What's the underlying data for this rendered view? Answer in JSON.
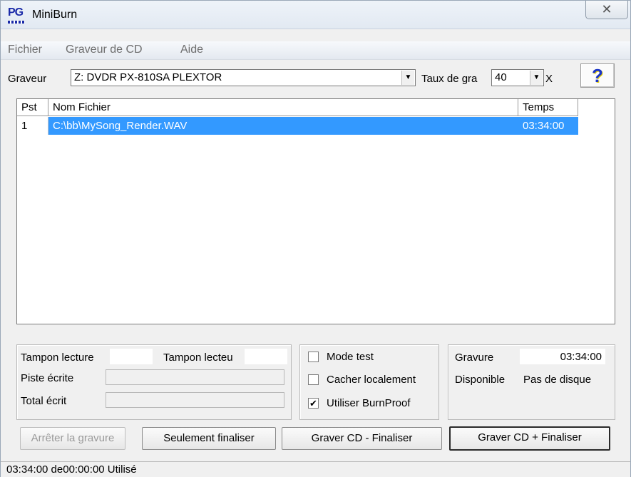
{
  "window": {
    "title": "MiniBurn",
    "close_glyph": "✕"
  },
  "menu": [
    "Fichier",
    "Graveur de CD",
    "Aide"
  ],
  "drive": {
    "label": "Graveur",
    "value": "Z: DVDR  PX-810SA  PLEXTOR"
  },
  "speed": {
    "label": "Taux de gra",
    "value": "40",
    "unit": "X"
  },
  "help": {
    "glyph": "?"
  },
  "list": {
    "columns": [
      "Pst",
      "Nom Fichier",
      "Temps"
    ],
    "rows": [
      {
        "pst": "1",
        "file": "C:\\bb\\MySong_Render.WAV",
        "time": "03:34:00"
      }
    ]
  },
  "buffers": {
    "read_label": "Tampon lecture",
    "reader_label": "Tampon lecteu",
    "track_label": "Piste écrite",
    "total_label": "Total écrit"
  },
  "options": {
    "test_mode": {
      "label": "Mode test",
      "checked": false
    },
    "cache_local": {
      "label": "Cacher localement",
      "checked": false
    },
    "burnproof": {
      "label": "Utiliser BurnProof",
      "checked": true,
      "mark": "✔"
    }
  },
  "info": {
    "burn_label": "Gravure",
    "burn_value": "03:34:00",
    "available_label": "Disponible",
    "available_value": "Pas de disque"
  },
  "buttons": {
    "stop": "Arrêter la gravure",
    "finalize_only": "Seulement finaliser",
    "burn_no_finalize": "Graver CD - Finaliser",
    "burn_finalize": "Graver CD + Finaliser"
  },
  "status": "03:34:00 de00:00:00 Utilisé",
  "icons": {
    "app": "pg-music-logo-icon",
    "dropdown": "dropdown-arrow-icon",
    "help": "help-question-icon",
    "close": "close-icon"
  }
}
